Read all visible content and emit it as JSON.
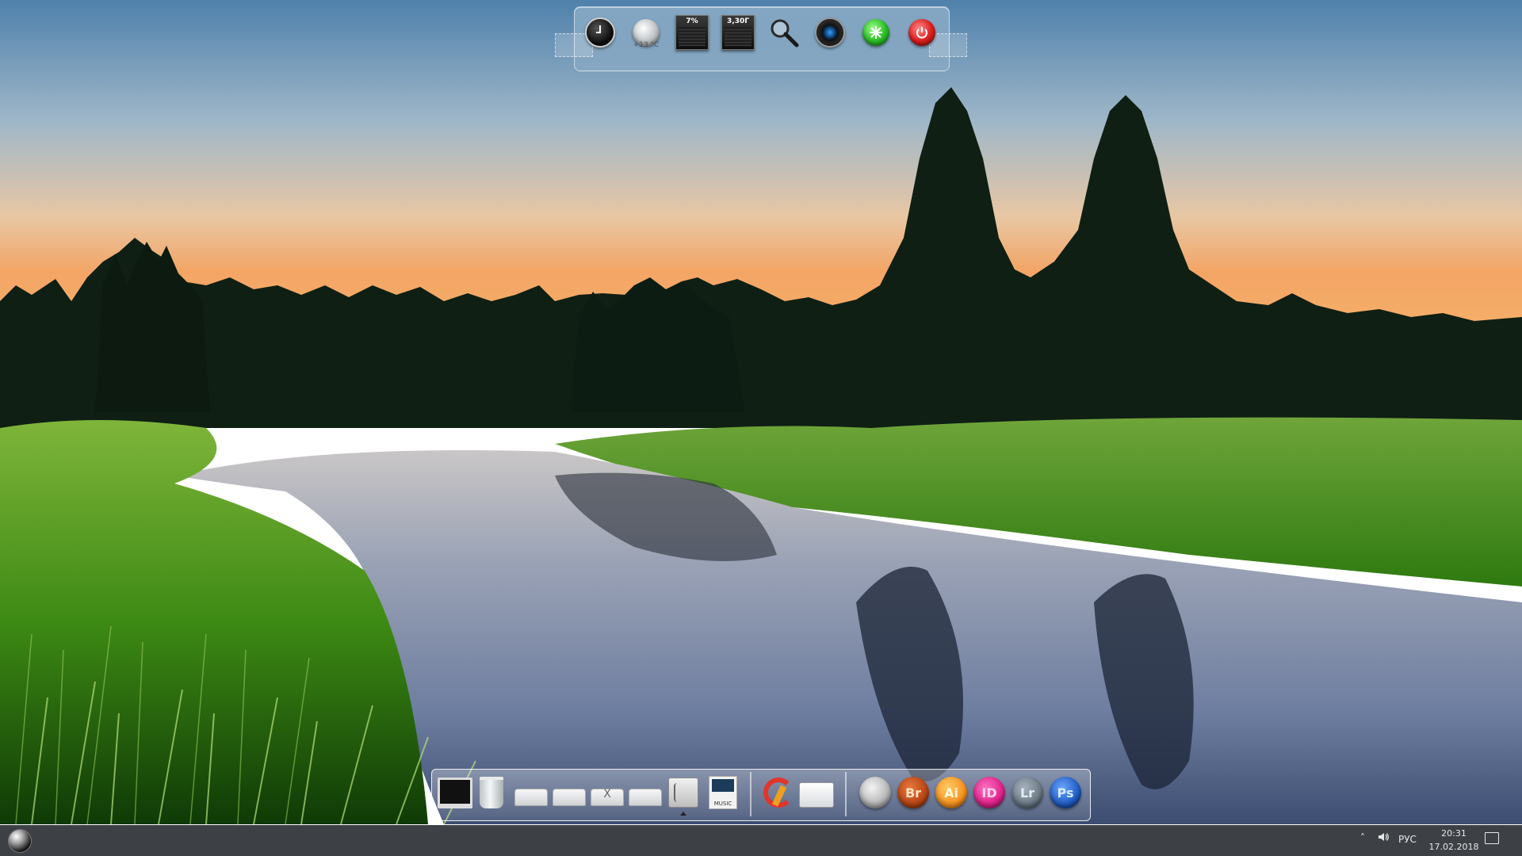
{
  "top_dock": {
    "weather_temp": "+13 °C",
    "cpu_meter": "7%",
    "ram_meter": "3,30Г",
    "icons": [
      "clock-icon",
      "weather-icon",
      "cpu-meter-icon",
      "ram-meter-icon",
      "search-icon",
      "camera-icon",
      "refresh-icon",
      "power-icon"
    ]
  },
  "bottom_dock": {
    "drive_marks": [
      "",
      "",
      "X",
      ""
    ],
    "music_label": "MUSIC",
    "apps": [
      {
        "name": "acrobat",
        "label": "",
        "color": "#c8c8c8"
      },
      {
        "name": "bridge",
        "label": "Br",
        "color": "#b84515"
      },
      {
        "name": "illustrator",
        "label": "Ai",
        "color": "#f7931e"
      },
      {
        "name": "indesign",
        "label": "ID",
        "color": "#e0218a"
      },
      {
        "name": "lightroom",
        "label": "Lr",
        "color": "#6b7a86"
      },
      {
        "name": "photoshop",
        "label": "Ps",
        "color": "#1f5cc2"
      }
    ]
  },
  "taskbar": {
    "chevron": "˄",
    "volume_glyph": "🔈",
    "language": "РУС",
    "time": "20:31",
    "date": "17.02.2018"
  },
  "colors": {
    "sky_top": "#5f8fb6",
    "sky_horizon": "#f2b982",
    "grass": "#4f9a1e",
    "water": "#6f7f9c",
    "taskbar": "#12161c"
  }
}
